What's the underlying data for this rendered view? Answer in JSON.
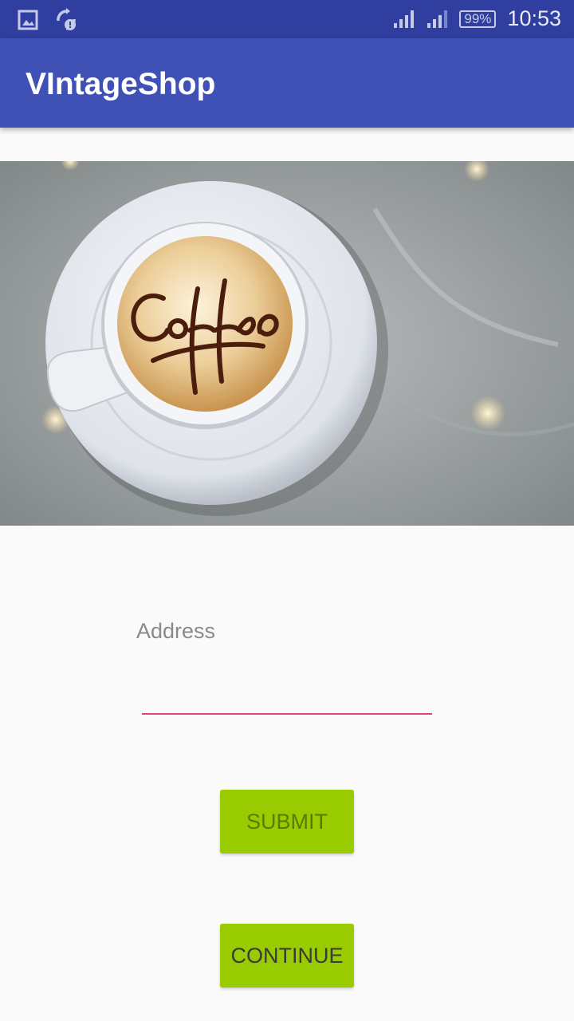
{
  "status_bar": {
    "icons": [
      "image-icon",
      "sync-alert-icon",
      "signal-icon",
      "signal-icon",
      "battery-icon"
    ],
    "battery": "99%",
    "time": "10:53"
  },
  "app_bar": {
    "title": "VIntageShop"
  },
  "hero_image": {
    "subject": "coffee-cup",
    "latte_art_text": "Coffee"
  },
  "form": {
    "address_label": "Address",
    "address_value": "",
    "submit_label": "SUBMIT",
    "continue_label": "CONTINUE"
  },
  "colors": {
    "status_bar": "#303f9f",
    "app_bar": "#3f51b5",
    "accent": "#e0457b",
    "button": "#99cc00",
    "background": "#fafafa"
  }
}
